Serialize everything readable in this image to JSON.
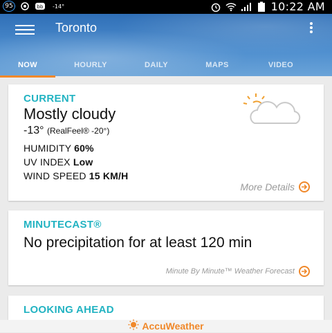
{
  "status_bar": {
    "badge": "95",
    "temp": "-14°",
    "time": "10:22 AM"
  },
  "header": {
    "city": "Toronto",
    "tabs": [
      {
        "label": "NOW",
        "active": true
      },
      {
        "label": "HOURLY",
        "active": false
      },
      {
        "label": "DAILY",
        "active": false
      },
      {
        "label": "MAPS",
        "active": false
      },
      {
        "label": "VIDEO",
        "active": false
      }
    ]
  },
  "current": {
    "title": "CURRENT",
    "condition": "Mostly cloudy",
    "temperature": "-13°",
    "realfeel": "(RealFeel® -20°)",
    "humidity_label": "HUMIDITY",
    "humidity_value": "60%",
    "uv_label": "UV INDEX",
    "uv_value": "Low",
    "wind_label": "WIND SPEED",
    "wind_value": "15 KM/H",
    "more_details": "More Details",
    "icon": "partly-cloudy-icon"
  },
  "minutecast": {
    "title": "MINUTECAST®",
    "summary": "No precipitation for at least 120 min",
    "link": "Minute By Minute™ Weather Forecast"
  },
  "looking_ahead": {
    "title": "LOOKING AHEAD"
  },
  "brand": {
    "name": "AccuWeather"
  },
  "colors": {
    "accent": "#f0882a",
    "title": "#22b3c2"
  }
}
